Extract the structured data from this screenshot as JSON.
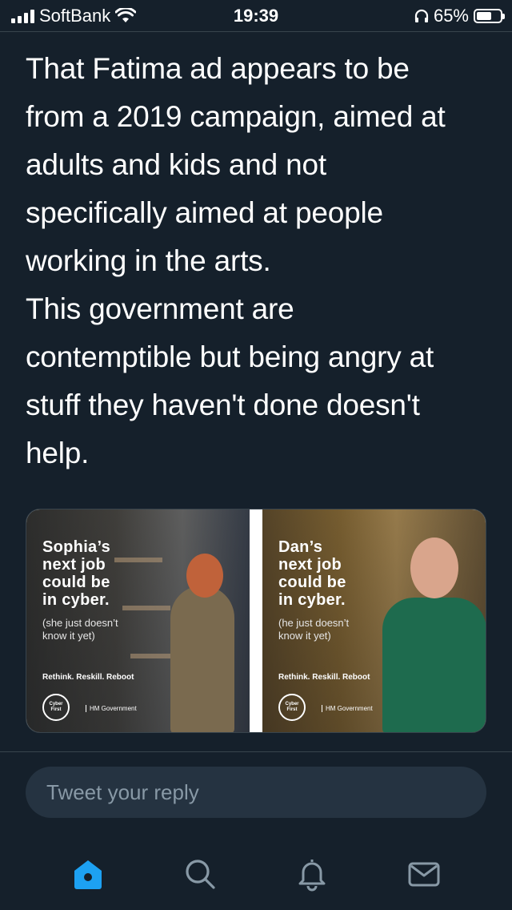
{
  "status_bar": {
    "carrier": "SoftBank",
    "time": "19:39",
    "battery_percent": "65%",
    "battery_level": 0.65,
    "icons": [
      "signal-icon",
      "wifi-icon",
      "headphones-icon",
      "battery-icon"
    ]
  },
  "tweet": {
    "text": "That Fatima ad appears to be\nfrom a 2019 campaign, aimed at\nadults and kids and not\nspecifically aimed at people\nworking in the arts.\nThis government are\ncontemptible but being angry at\nstuff they haven't done doesn't\nhelp."
  },
  "media": {
    "ads": [
      {
        "headline": "Sophia’s\nnext job\ncould be\nin cyber.",
        "sub": "(she just doesn’t\nknow it yet)",
        "tagline": "Rethink. Reskill. Reboot",
        "logo": "Cyber\nFirst",
        "gov": "HM Government"
      },
      {
        "headline": "Dan’s\nnext job\ncould be\nin cyber.",
        "sub": "(he just doesn’t\nknow it yet)",
        "tagline": "Rethink. Reskill. Reboot",
        "logo": "Cyber\nFirst",
        "gov": "HM Government"
      }
    ]
  },
  "reply": {
    "placeholder": "Tweet your reply"
  },
  "tab_bar": {
    "tabs": [
      "home-icon",
      "search-icon",
      "notifications-icon",
      "messages-icon"
    ],
    "active": "home-icon"
  },
  "colors": {
    "background": "#15202b",
    "accent": "#1da1f2",
    "muted": "#8899a6",
    "reply_bg": "#253341",
    "divider": "#38444d"
  }
}
